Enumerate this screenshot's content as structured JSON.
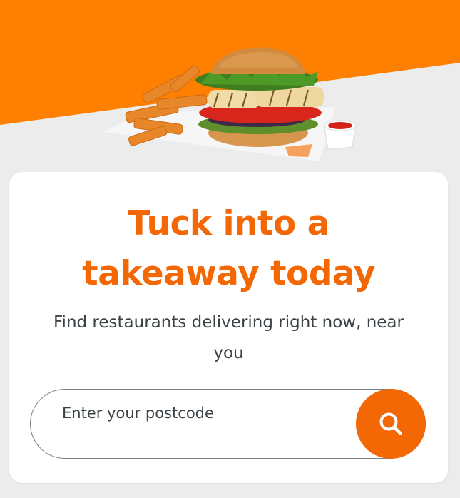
{
  "hero": {
    "image": "burger-fries-icon",
    "accent_color": "#ff8000",
    "background_color": "#ececec"
  },
  "card": {
    "headline_line1": "Tuck into a",
    "headline_line2": "takeaway today",
    "subtitle_line1": "Find restaurants delivering right now, near",
    "subtitle_line2": "you",
    "headline_color": "#f36805"
  },
  "search": {
    "placeholder": "Enter your postcode",
    "value": "",
    "button_icon": "search-icon",
    "button_color": "#f36805"
  }
}
